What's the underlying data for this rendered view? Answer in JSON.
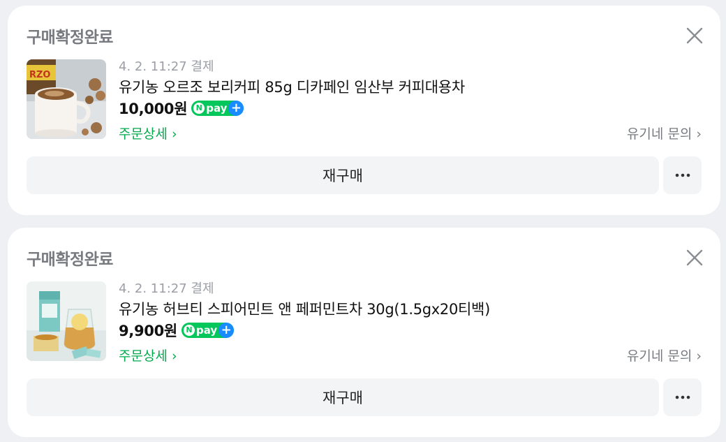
{
  "orders": [
    {
      "status": "구매확정완료",
      "date": "4. 2. 11:27 결제",
      "product_name": "유기농 오르조 보리커피 85g 디카페인 임산부 커피대용차",
      "price": "10,000원",
      "npay_label": "pay",
      "npay_mark": "N",
      "npay_plus": "+",
      "order_detail": "주문상세 ›",
      "seller": "유기네 문의 ›",
      "rebuy": "재구매",
      "more_icon": "more-horizontal-icon",
      "close_icon": "close-icon",
      "thumbnail": "orzo-barley-coffee-product-photo"
    },
    {
      "status": "구매확정완료",
      "date": "4. 2. 11:27 결제",
      "product_name": "유기농 허브티 스피어민트 앤 페퍼민트차 30g(1.5gx20티백)",
      "price": "9,900원",
      "npay_label": "pay",
      "npay_mark": "N",
      "npay_plus": "+",
      "order_detail": "주문상세 ›",
      "seller": "유기네 문의 ›",
      "rebuy": "재구매",
      "more_icon": "more-horizontal-icon",
      "close_icon": "close-icon",
      "thumbnail": "herb-tea-product-photo"
    }
  ],
  "colors": {
    "background": "#eef0f3",
    "status_text": "#777b80",
    "accent_green": "#03a94d",
    "npay_green": "#03c75a",
    "npay_blue": "#1a8cff"
  }
}
